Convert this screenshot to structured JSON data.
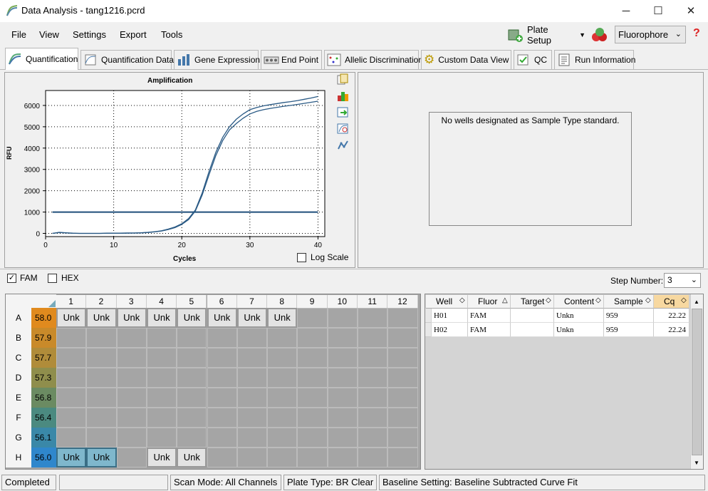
{
  "window": {
    "title": "Data Analysis - tang1216.pcrd",
    "minimize": "─",
    "maximize": "☐",
    "close": "✕"
  },
  "menu": {
    "file": "File",
    "view": "View",
    "settings": "Settings",
    "export": "Export",
    "tools": "Tools"
  },
  "toolbar": {
    "plate_setup": "Plate Setup",
    "fluorophore": "Fluorophore",
    "help": "?"
  },
  "tabs": [
    "Quantification",
    "Quantification Data",
    "Gene Expression",
    "End Point",
    "Allelic Discrimination",
    "Custom Data View",
    "QC",
    "Run Information"
  ],
  "std_panel": {
    "message": "No wells designated as Sample Type standard."
  },
  "chart_data": {
    "type": "line",
    "title": "Amplification",
    "xlabel": "Cycles",
    "ylabel": "RFU",
    "xlim": [
      0,
      41
    ],
    "ylim": [
      -150,
      6700
    ],
    "xticks": [
      0,
      10,
      20,
      30,
      40
    ],
    "yticks": [
      0,
      1000,
      2000,
      3000,
      4000,
      5000,
      6000
    ],
    "grid": true,
    "threshold": 1000,
    "series": [
      {
        "x": [
          1,
          2,
          3,
          4,
          5,
          6,
          7,
          8,
          9,
          10,
          11,
          12,
          13,
          14,
          15,
          16,
          17,
          18,
          19,
          20,
          21,
          22,
          23,
          24,
          25,
          26,
          27,
          28,
          29,
          30,
          31,
          32,
          33,
          34,
          35,
          36,
          37,
          38,
          39,
          40
        ],
        "values": [
          0,
          50,
          30,
          10,
          0,
          0,
          0,
          0,
          10,
          10,
          10,
          20,
          20,
          30,
          50,
          80,
          120,
          200,
          300,
          450,
          700,
          1100,
          1900,
          2900,
          3800,
          4500,
          5000,
          5350,
          5600,
          5800,
          5900,
          5980,
          6040,
          6090,
          6140,
          6180,
          6230,
          6290,
          6350,
          6420
        ]
      },
      {
        "x": [
          1,
          2,
          3,
          4,
          5,
          6,
          7,
          8,
          9,
          10,
          11,
          12,
          13,
          14,
          15,
          16,
          17,
          18,
          19,
          20,
          21,
          22,
          23,
          24,
          25,
          26,
          27,
          28,
          29,
          30,
          31,
          32,
          33,
          34,
          35,
          36,
          37,
          38,
          39,
          40
        ],
        "values": [
          0,
          40,
          20,
          5,
          0,
          0,
          0,
          0,
          5,
          5,
          5,
          10,
          15,
          25,
          40,
          70,
          110,
          180,
          270,
          420,
          650,
          1050,
          1800,
          2750,
          3650,
          4350,
          4850,
          5150,
          5400,
          5600,
          5720,
          5800,
          5860,
          5910,
          5960,
          6000,
          6050,
          6100,
          6150,
          6200
        ]
      }
    ],
    "log_scale_label": "Log Scale"
  },
  "fluors": {
    "fam": "FAM",
    "hex": "HEX"
  },
  "step": {
    "label": "Step Number:",
    "value": "3"
  },
  "plate": {
    "cols": [
      "1",
      "2",
      "3",
      "4",
      "5",
      "6",
      "7",
      "8",
      "9",
      "10",
      "11",
      "12"
    ],
    "rows": [
      "A",
      "B",
      "C",
      "D",
      "E",
      "F",
      "G",
      "H"
    ],
    "temps": [
      "58.0",
      "57.9",
      "57.7",
      "57.3",
      "56.8",
      "56.4",
      "56.1",
      "56.0"
    ],
    "temp_colors": [
      "#e08a1e",
      "#c98a2a",
      "#b08c3a",
      "#8f8e4c",
      "#6b8b62",
      "#4b8a80",
      "#3a88a8",
      "#2f87cc"
    ],
    "well_label": "Unk"
  },
  "results": {
    "headers": [
      "Well",
      "Fluor",
      "Target",
      "Content",
      "Sample",
      "Cq"
    ],
    "rows": [
      [
        "H01",
        "FAM",
        "",
        "Unkn",
        "959",
        "22.22"
      ],
      [
        "H02",
        "FAM",
        "",
        "Unkn",
        "959",
        "22.24"
      ]
    ]
  },
  "status": {
    "state": "Completed",
    "scan_mode": "Scan Mode: All Channels",
    "plate_type": "Plate Type: BR Clear",
    "baseline": "Baseline Setting: Baseline Subtracted Curve Fit"
  }
}
